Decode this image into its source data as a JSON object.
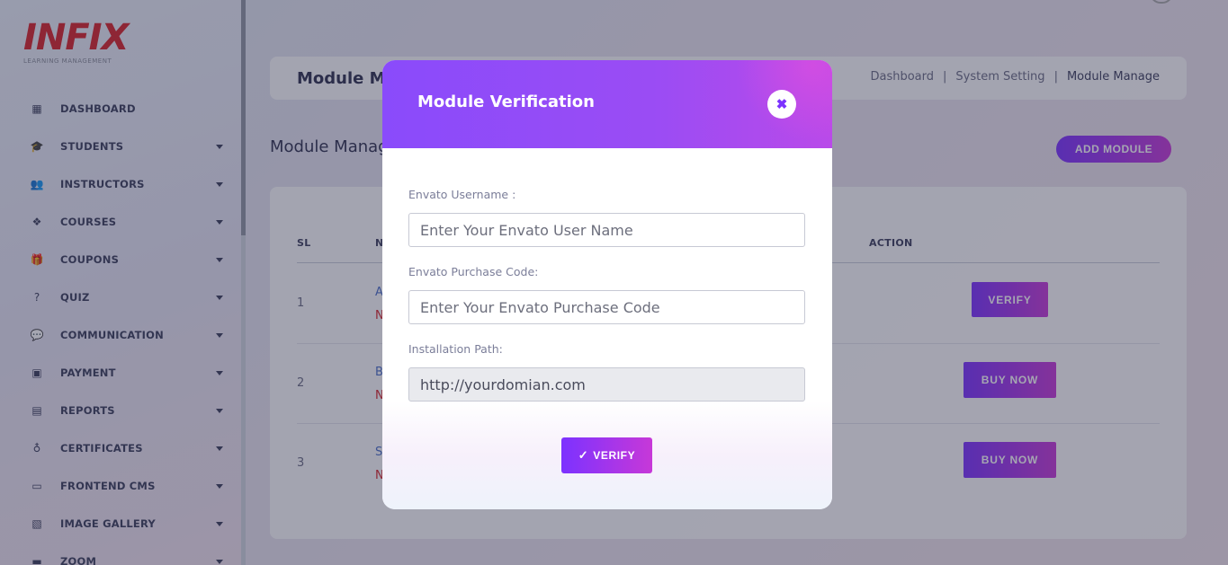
{
  "brand": {
    "logo_text": "INFIX",
    "tagline": "LEARNING MANAGEMENT"
  },
  "sidebar": {
    "items": [
      {
        "label": "DASHBOARD",
        "icon": "grid-icon",
        "glyph": "▦",
        "has_caret": false
      },
      {
        "label": "STUDENTS",
        "icon": "graduation-cap-icon",
        "glyph": "🎓",
        "has_caret": true
      },
      {
        "label": "INSTRUCTORS",
        "icon": "users-icon",
        "glyph": "👥",
        "has_caret": true
      },
      {
        "label": "COURSES",
        "icon": "cubes-icon",
        "glyph": "❖",
        "has_caret": true
      },
      {
        "label": "COUPONS",
        "icon": "gift-icon",
        "glyph": "🎁",
        "has_caret": true
      },
      {
        "label": "QUIZ",
        "icon": "question-icon",
        "glyph": "?",
        "has_caret": true
      },
      {
        "label": "COMMUNICATION",
        "icon": "comments-icon",
        "glyph": "💬",
        "has_caret": true
      },
      {
        "label": "PAYMENT",
        "icon": "money-icon",
        "glyph": "▣",
        "has_caret": true
      },
      {
        "label": "REPORTS",
        "icon": "calculator-icon",
        "glyph": "▤",
        "has_caret": true
      },
      {
        "label": "CERTIFICATES",
        "icon": "award-icon",
        "glyph": "♁",
        "has_caret": true
      },
      {
        "label": "FRONTEND CMS",
        "icon": "desktop-icon",
        "glyph": "▭",
        "has_caret": true
      },
      {
        "label": "IMAGE GALLERY",
        "icon": "images-icon",
        "glyph": "▧",
        "has_caret": true
      },
      {
        "label": "ZOOM",
        "icon": "video-icon",
        "glyph": "▬",
        "has_caret": true
      }
    ]
  },
  "header": {
    "title": "Module Manage",
    "breadcrumb": [
      "Dashboard",
      "System Setting",
      "Module Manage"
    ],
    "breadcrumb_sep": "|"
  },
  "main": {
    "section_title": "Module Manage",
    "add_module_label": "ADD MODULE",
    "table": {
      "columns": {
        "sl": "SL",
        "name": "NAME",
        "action": "ACTION"
      },
      "rows": [
        {
          "sl": "1",
          "name": "A",
          "sub": "N",
          "action": "VERIFY"
        },
        {
          "sl": "2",
          "name": "B",
          "sub": "N",
          "action": "BUY NOW"
        },
        {
          "sl": "3",
          "name": "S",
          "sub": "N",
          "action": "BUY NOW"
        }
      ]
    }
  },
  "modal": {
    "title": "Module Verification",
    "close_glyph": "✖",
    "fields": {
      "username": {
        "label": "Envato Username :",
        "placeholder": "Enter Your Envato User Name",
        "value": ""
      },
      "purchase_code": {
        "label": "Envato Purchase Code:",
        "placeholder": "Enter Your Envato Purchase Code",
        "value": ""
      },
      "installation_path": {
        "label": "Installation Path:",
        "value": "http://yourdomian.com"
      }
    },
    "verify_label": "VERIFY",
    "verify_glyph": "✓"
  },
  "colors": {
    "accent_start": "#7c32ff",
    "accent_end": "#c738d8",
    "logo_red": "#d8232a"
  }
}
